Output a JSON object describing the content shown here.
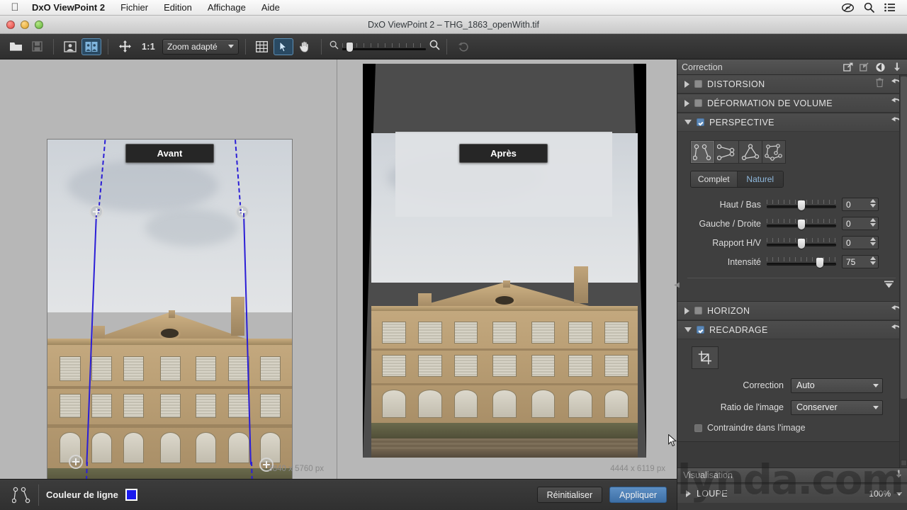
{
  "menubar": {
    "app_name": "DxO ViewPoint 2",
    "items": [
      {
        "label": "Fichier"
      },
      {
        "label": "Edition"
      },
      {
        "label": "Affichage"
      },
      {
        "label": "Aide"
      }
    ],
    "right_icons": [
      {
        "name": "creative-cloud-icon"
      },
      {
        "name": "spotlight-search-icon"
      },
      {
        "name": "notification-center-icon"
      }
    ]
  },
  "window": {
    "title": "DxO ViewPoint 2 – THG_1863_openWith.tif"
  },
  "toolbar": {
    "open_label": "open-folder",
    "save_label": "save",
    "single_view_label": "single-view",
    "compare_view_label": "compare-view",
    "move_label": "move-tool",
    "one_to_one": "1:1",
    "zoom_mode": "Zoom adapté",
    "grid_label": "grid",
    "pointer_label": "pointer-tool",
    "hand_label": "hand-tool",
    "undo_label": "undo"
  },
  "viewer": {
    "before_label": "Avant",
    "after_label": "Après",
    "before_dimensions": "3840 x 5760 px",
    "after_dimensions": "4444 x 6119 px"
  },
  "panel": {
    "title": "Correction",
    "header_icons": [
      {
        "name": "export-preset-icon"
      },
      {
        "name": "import-preset-icon"
      },
      {
        "name": "reset-all-icon"
      },
      {
        "name": "collapse-all-icon"
      }
    ],
    "sections": [
      {
        "id": "distorsion",
        "title": "DISTORSION",
        "expanded": false,
        "checked": false,
        "has_trash": true
      },
      {
        "id": "deformation",
        "title": "DÉFORMATION DE VOLUME",
        "expanded": false,
        "checked": false,
        "has_trash": false
      },
      {
        "id": "perspective",
        "title": "PERSPECTIVE",
        "expanded": true,
        "checked": true,
        "has_trash": false
      },
      {
        "id": "horizon",
        "title": "HORIZON",
        "expanded": false,
        "checked": false,
        "has_trash": false
      },
      {
        "id": "recadrage",
        "title": "RECADRAGE",
        "expanded": true,
        "checked": true,
        "has_trash": false
      }
    ],
    "perspective": {
      "tools": [
        {
          "name": "two-vertical-lines-tool",
          "selected": true
        },
        {
          "name": "two-horizontal-lines-tool",
          "selected": false
        },
        {
          "name": "rectangle-three-point-tool",
          "selected": false
        },
        {
          "name": "rectangle-eight-point-tool",
          "selected": false
        }
      ],
      "mode_segments": [
        {
          "label": "Complet",
          "active": false
        },
        {
          "label": "Naturel",
          "active": true
        }
      ],
      "sliders": [
        {
          "label": "Haut / Bas",
          "value": "0",
          "knob_pct": 50
        },
        {
          "label": "Gauche / Droite",
          "value": "0",
          "knob_pct": 50
        },
        {
          "label": "Rapport H/V",
          "value": "0",
          "knob_pct": 50
        },
        {
          "label": "Intensité",
          "value": "75",
          "knob_pct": 75
        }
      ]
    },
    "recadrage": {
      "crop_tool_name": "crop-tool",
      "fields": [
        {
          "label": "Correction",
          "value": "Auto"
        },
        {
          "label": "Ratio de l'image",
          "value": "Conserver"
        }
      ],
      "constrain": {
        "label": "Contraindre dans l'image",
        "checked": false
      }
    },
    "visualisation": {
      "title": "Visualisation",
      "loupe_label": "LOUPE",
      "loupe_zoom": "100%"
    }
  },
  "bottombar": {
    "tool_icon_name": "two-vertical-lines-tool",
    "line_color_label": "Couleur de ligne",
    "line_color_hex": "#1a1aee",
    "reset_label": "Réinitialiser",
    "apply_label": "Appliquer"
  },
  "watermark": {
    "text": "lynda.com"
  }
}
